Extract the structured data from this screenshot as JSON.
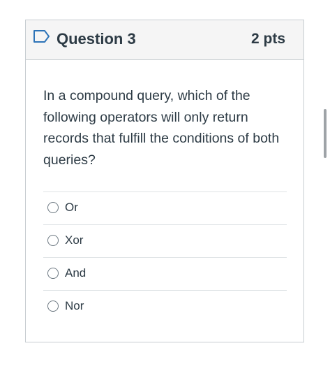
{
  "question": {
    "title": "Question 3",
    "points": "2 pts",
    "text": "In a compound query, which of the following operators will only return records that fulfill the conditions of both queries?"
  },
  "answers": [
    {
      "label": "Or"
    },
    {
      "label": "Xor"
    },
    {
      "label": "And"
    },
    {
      "label": "Nor"
    }
  ],
  "icons": {
    "flag": "flag-outline-icon",
    "radio": "radio-unselected"
  },
  "colors": {
    "accent": "#2d3b45",
    "flag": "#2d74b8",
    "header_bg": "#f5f5f5",
    "border": "#c7cdd1"
  }
}
